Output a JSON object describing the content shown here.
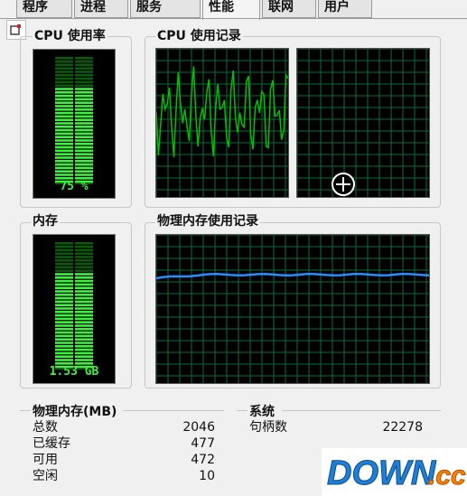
{
  "tabs": [
    {
      "label": "程序"
    },
    {
      "label": "进程"
    },
    {
      "label": "服务"
    },
    {
      "label": "性能"
    },
    {
      "label": "联网"
    },
    {
      "label": "用户"
    }
  ],
  "cpu_usage": {
    "title": "CPU 使用率",
    "value_label": "75 %",
    "level": 0.75
  },
  "cpu_history": {
    "title": "CPU 使用记录"
  },
  "memory": {
    "title": "内存",
    "value_label": "1.53 GB",
    "level": 0.75
  },
  "memory_history": {
    "title": "物理内存使用记录"
  },
  "physical_memory": {
    "title": "物理内存(MB)",
    "rows": [
      {
        "label": "总数",
        "value": "2046"
      },
      {
        "label": "已缓存",
        "value": "477"
      },
      {
        "label": "可用",
        "value": "472"
      },
      {
        "label": "空闲",
        "value": "10"
      }
    ]
  },
  "system": {
    "title": "系统",
    "rows": [
      {
        "label": "句柄数",
        "value": "22278"
      }
    ]
  },
  "watermark": {
    "text": "DOWN.cc"
  },
  "colors": {
    "graph_green": "#00c000",
    "bar_green": "#3ff03f",
    "memory_line": "#2a8cff",
    "grid": "#0b6b3a"
  }
}
